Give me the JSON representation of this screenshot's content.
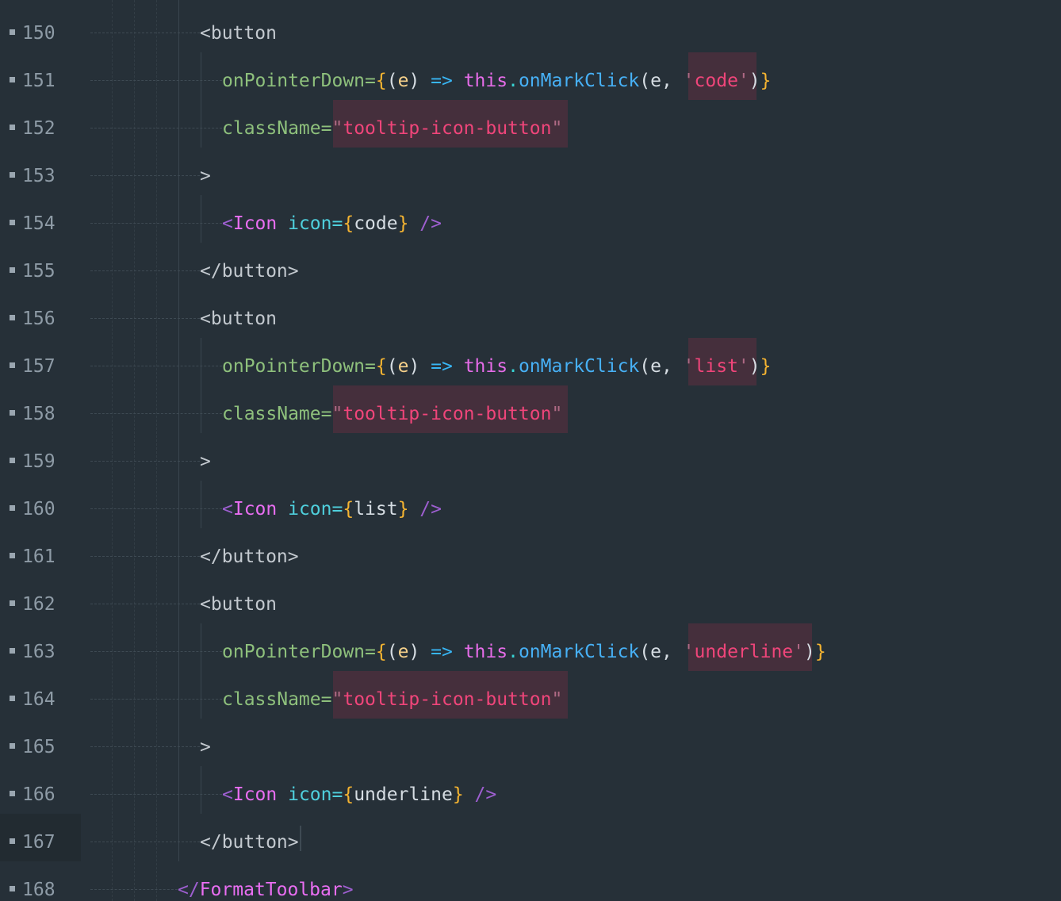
{
  "colors": {
    "background": "#263038",
    "string_highlight": "#452f3c",
    "line_number": "#8e9ba6"
  },
  "icons": {
    "fold_marker": "fold-square-icon"
  },
  "lines": [
    {
      "num": "150",
      "t0": "<button"
    },
    {
      "num": "151",
      "t0": "onPointerDown=",
      "t1": "{",
      "t2": "(",
      "t3": "e",
      "t4": ")",
      "t5": " => ",
      "t6": "this",
      "t7": ".",
      "t8": "onMarkClick",
      "t9": "(e, ",
      "t10": "'",
      "t11": "code",
      "t12": "'",
      "t13": ")",
      "t14": "}"
    },
    {
      "num": "152",
      "t0": "className=",
      "t1": "\"",
      "t2": "tooltip-icon-button",
      "t3": "\""
    },
    {
      "num": "153",
      "t0": ">"
    },
    {
      "num": "154",
      "t0": "<",
      "t1": "Icon",
      "t2": " icon=",
      "t3": "{",
      "t4": "code",
      "t5": "}",
      "t6": " />"
    },
    {
      "num": "155",
      "t0": "</button>"
    },
    {
      "num": "156",
      "t0": "<button"
    },
    {
      "num": "157",
      "t0": "onPointerDown=",
      "t1": "{",
      "t2": "(",
      "t3": "e",
      "t4": ")",
      "t5": " => ",
      "t6": "this",
      "t7": ".",
      "t8": "onMarkClick",
      "t9": "(e, ",
      "t10": "'",
      "t11": "list",
      "t12": "'",
      "t13": ")",
      "t14": "}"
    },
    {
      "num": "158",
      "t0": "className=",
      "t1": "\"",
      "t2": "tooltip-icon-button",
      "t3": "\""
    },
    {
      "num": "159",
      "t0": ">"
    },
    {
      "num": "160",
      "t0": "<",
      "t1": "Icon",
      "t2": " icon=",
      "t3": "{",
      "t4": "list",
      "t5": "}",
      "t6": " />"
    },
    {
      "num": "161",
      "t0": "</button>"
    },
    {
      "num": "162",
      "t0": "<button"
    },
    {
      "num": "163",
      "t0": "onPointerDown=",
      "t1": "{",
      "t2": "(",
      "t3": "e",
      "t4": ")",
      "t5": " => ",
      "t6": "this",
      "t7": ".",
      "t8": "onMarkClick",
      "t9": "(e, ",
      "t10": "'",
      "t11": "underline",
      "t12": "'",
      "t13": ")",
      "t14": "}"
    },
    {
      "num": "164",
      "t0": "className=",
      "t1": "\"",
      "t2": "tooltip-icon-button",
      "t3": "\""
    },
    {
      "num": "165",
      "t0": ">"
    },
    {
      "num": "166",
      "t0": "<",
      "t1": "Icon",
      "t2": " icon=",
      "t3": "{",
      "t4": "underline",
      "t5": "}",
      "t6": " />"
    },
    {
      "num": "167",
      "t0": "</button>"
    },
    {
      "num": "168",
      "t0": "</",
      "t1": "FormatToolbar",
      "t2": ">"
    }
  ]
}
